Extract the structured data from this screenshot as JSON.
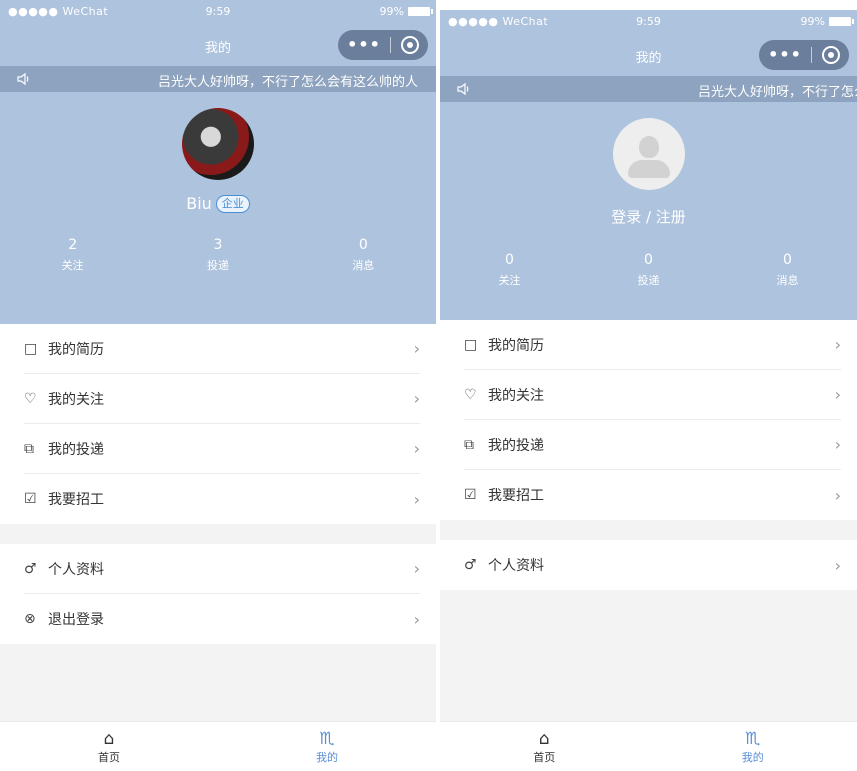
{
  "status_bar": {
    "carrier": "●●●●● WeChat",
    "wifi": "ᵯ",
    "time": "9:59",
    "battery": "99%"
  },
  "nav": {
    "title": "我的",
    "more": "•••"
  },
  "notice": {
    "text": "吕光大人好帅呀，不行了怎么会有这么帅的人"
  },
  "screen_logged_in": {
    "username": "Biu",
    "badge": "企业",
    "stats": [
      {
        "value": "2",
        "label": "关注"
      },
      {
        "value": "3",
        "label": "投递"
      },
      {
        "value": "0",
        "label": "消息"
      }
    ],
    "menu_group1": [
      {
        "icon": "□",
        "label": "我的简历"
      },
      {
        "icon": "♡",
        "label": "我的关注"
      },
      {
        "icon": "⧉",
        "label": "我的投递"
      },
      {
        "icon": "☑",
        "label": "我要招工"
      }
    ],
    "menu_group2": [
      {
        "icon": "♂",
        "label": "个人资料"
      },
      {
        "icon": "⊗",
        "label": "退出登录"
      }
    ]
  },
  "screen_logged_out": {
    "login_text": "登录 / 注册",
    "stats": [
      {
        "value": "0",
        "label": "关注"
      },
      {
        "value": "0",
        "label": "投递"
      },
      {
        "value": "0",
        "label": "消息"
      }
    ],
    "menu_group1": [
      {
        "icon": "□",
        "label": "我的简历"
      },
      {
        "icon": "♡",
        "label": "我的关注"
      },
      {
        "icon": "⧉",
        "label": "我的投递"
      },
      {
        "icon": "☑",
        "label": "我要招工"
      }
    ],
    "menu_group2": [
      {
        "icon": "♂",
        "label": "个人资料"
      }
    ]
  },
  "tabbar": [
    {
      "icon": "⌂",
      "label": "首页",
      "active": false
    },
    {
      "icon": "♏",
      "label": "我的",
      "active": true
    }
  ],
  "chevron": "›",
  "colors": {
    "header_bg": "#aec3dd",
    "notice_bg": "#8ea3bf",
    "capsule": "#6b7f9c",
    "accent": "#5a8fd6"
  }
}
